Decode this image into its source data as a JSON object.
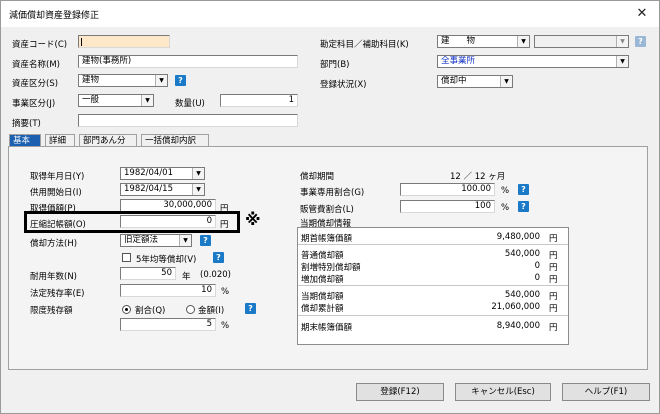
{
  "window": {
    "title": "減価償却資産登録修正",
    "close": "✕"
  },
  "header": {
    "asset_code_label": "資産コード(C)",
    "asset_code_value": "",
    "asset_name_label": "資産名称(M)",
    "asset_name_value": "建物(事務所)",
    "asset_type_label": "資産区分(S)",
    "asset_type_value": "建物",
    "business_type_label": "事業区分(J)",
    "business_type_value": "一般",
    "quantity_label": "数量(U)",
    "quantity_value": "1",
    "summary_label": "摘要(T)",
    "summary_value": "",
    "account_label": "勘定科目／補助科目(K)",
    "account_value": "建　　物",
    "sub_account_value": "",
    "dept_label": "部門(B)",
    "dept_value": "全事業所",
    "status_label": "登録状況(X)",
    "status_value": "償却中",
    "help": "?"
  },
  "tabs": [
    {
      "label": "基本"
    },
    {
      "label": "詳細"
    },
    {
      "label": "部門あん分"
    },
    {
      "label": "一括償却内訳"
    }
  ],
  "basic": {
    "acq_date_label": "取得年月日(Y)",
    "acq_date_value": "1982/04/01",
    "use_date_label": "供用開始日(I)",
    "use_date_value": "1982/04/15",
    "acq_price_label": "取得価額(P)",
    "acq_price_value": "30,000,000",
    "compress_label": "圧縮記帳額(O)",
    "compress_value": "0",
    "yen": "円",
    "note_mark": "※",
    "method_label": "償却方法(H)",
    "method_value": "旧定額法",
    "equal5_label": "5年均等償却(V)",
    "life_label": "耐用年数(N)",
    "life_value": "50",
    "year_unit": "年",
    "life_rate": "(0.020)",
    "residual_label": "法定残存率(E)",
    "residual_value": "10",
    "percent": "%",
    "limit_label": "限度残存額",
    "limit_ratio_label": "割合(Q)",
    "limit_amount_label": "金額(I)",
    "limit_value": "5",
    "period_label": "償却期間",
    "period_value": "12 ／ 12 ヶ月",
    "biz_ratio_label": "事業専用割合(G)",
    "biz_ratio_value": "100.00",
    "sales_ratio_label": "販管費割合(L)",
    "sales_ratio_value": "100",
    "current_group_label": "当期償却情報",
    "rows": [
      {
        "label": "期首帳簿価額",
        "value": "9,480,000",
        "unit": "円"
      },
      {
        "label": "普通償却額",
        "value": "540,000",
        "unit": "円"
      },
      {
        "label": "割増特別償却額",
        "value": "0",
        "unit": "円"
      },
      {
        "label": "増加償却額",
        "value": "0",
        "unit": "円"
      },
      {
        "label": "当期償却額",
        "value": "540,000",
        "unit": "円"
      },
      {
        "label": "償却累計額",
        "value": "21,060,000",
        "unit": "円"
      },
      {
        "label": "期末帳簿価額",
        "value": "8,940,000",
        "unit": "円"
      }
    ]
  },
  "buttons": {
    "register": "登録(F12)",
    "cancel": "キャンセル(Esc)",
    "help": "ヘルプ(F1)"
  }
}
